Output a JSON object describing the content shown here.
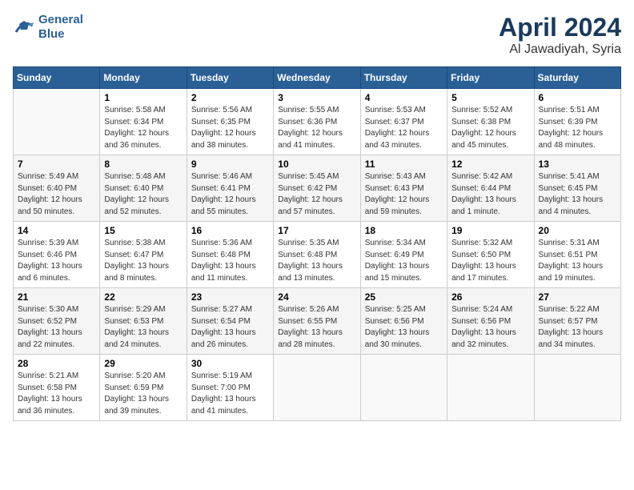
{
  "header": {
    "logo_line1": "General",
    "logo_line2": "Blue",
    "month": "April 2024",
    "location": "Al Jawadiyah, Syria"
  },
  "weekdays": [
    "Sunday",
    "Monday",
    "Tuesday",
    "Wednesday",
    "Thursday",
    "Friday",
    "Saturday"
  ],
  "weeks": [
    [
      {
        "day": "",
        "content": ""
      },
      {
        "day": "1",
        "content": "Sunrise: 5:58 AM\nSunset: 6:34 PM\nDaylight: 12 hours\nand 36 minutes."
      },
      {
        "day": "2",
        "content": "Sunrise: 5:56 AM\nSunset: 6:35 PM\nDaylight: 12 hours\nand 38 minutes."
      },
      {
        "day": "3",
        "content": "Sunrise: 5:55 AM\nSunset: 6:36 PM\nDaylight: 12 hours\nand 41 minutes."
      },
      {
        "day": "4",
        "content": "Sunrise: 5:53 AM\nSunset: 6:37 PM\nDaylight: 12 hours\nand 43 minutes."
      },
      {
        "day": "5",
        "content": "Sunrise: 5:52 AM\nSunset: 6:38 PM\nDaylight: 12 hours\nand 45 minutes."
      },
      {
        "day": "6",
        "content": "Sunrise: 5:51 AM\nSunset: 6:39 PM\nDaylight: 12 hours\nand 48 minutes."
      }
    ],
    [
      {
        "day": "7",
        "content": "Sunrise: 5:49 AM\nSunset: 6:40 PM\nDaylight: 12 hours\nand 50 minutes."
      },
      {
        "day": "8",
        "content": "Sunrise: 5:48 AM\nSunset: 6:40 PM\nDaylight: 12 hours\nand 52 minutes."
      },
      {
        "day": "9",
        "content": "Sunrise: 5:46 AM\nSunset: 6:41 PM\nDaylight: 12 hours\nand 55 minutes."
      },
      {
        "day": "10",
        "content": "Sunrise: 5:45 AM\nSunset: 6:42 PM\nDaylight: 12 hours\nand 57 minutes."
      },
      {
        "day": "11",
        "content": "Sunrise: 5:43 AM\nSunset: 6:43 PM\nDaylight: 12 hours\nand 59 minutes."
      },
      {
        "day": "12",
        "content": "Sunrise: 5:42 AM\nSunset: 6:44 PM\nDaylight: 13 hours\nand 1 minute."
      },
      {
        "day": "13",
        "content": "Sunrise: 5:41 AM\nSunset: 6:45 PM\nDaylight: 13 hours\nand 4 minutes."
      }
    ],
    [
      {
        "day": "14",
        "content": "Sunrise: 5:39 AM\nSunset: 6:46 PM\nDaylight: 13 hours\nand 6 minutes."
      },
      {
        "day": "15",
        "content": "Sunrise: 5:38 AM\nSunset: 6:47 PM\nDaylight: 13 hours\nand 8 minutes."
      },
      {
        "day": "16",
        "content": "Sunrise: 5:36 AM\nSunset: 6:48 PM\nDaylight: 13 hours\nand 11 minutes."
      },
      {
        "day": "17",
        "content": "Sunrise: 5:35 AM\nSunset: 6:48 PM\nDaylight: 13 hours\nand 13 minutes."
      },
      {
        "day": "18",
        "content": "Sunrise: 5:34 AM\nSunset: 6:49 PM\nDaylight: 13 hours\nand 15 minutes."
      },
      {
        "day": "19",
        "content": "Sunrise: 5:32 AM\nSunset: 6:50 PM\nDaylight: 13 hours\nand 17 minutes."
      },
      {
        "day": "20",
        "content": "Sunrise: 5:31 AM\nSunset: 6:51 PM\nDaylight: 13 hours\nand 19 minutes."
      }
    ],
    [
      {
        "day": "21",
        "content": "Sunrise: 5:30 AM\nSunset: 6:52 PM\nDaylight: 13 hours\nand 22 minutes."
      },
      {
        "day": "22",
        "content": "Sunrise: 5:29 AM\nSunset: 6:53 PM\nDaylight: 13 hours\nand 24 minutes."
      },
      {
        "day": "23",
        "content": "Sunrise: 5:27 AM\nSunset: 6:54 PM\nDaylight: 13 hours\nand 26 minutes."
      },
      {
        "day": "24",
        "content": "Sunrise: 5:26 AM\nSunset: 6:55 PM\nDaylight: 13 hours\nand 28 minutes."
      },
      {
        "day": "25",
        "content": "Sunrise: 5:25 AM\nSunset: 6:56 PM\nDaylight: 13 hours\nand 30 minutes."
      },
      {
        "day": "26",
        "content": "Sunrise: 5:24 AM\nSunset: 6:56 PM\nDaylight: 13 hours\nand 32 minutes."
      },
      {
        "day": "27",
        "content": "Sunrise: 5:22 AM\nSunset: 6:57 PM\nDaylight: 13 hours\nand 34 minutes."
      }
    ],
    [
      {
        "day": "28",
        "content": "Sunrise: 5:21 AM\nSunset: 6:58 PM\nDaylight: 13 hours\nand 36 minutes."
      },
      {
        "day": "29",
        "content": "Sunrise: 5:20 AM\nSunset: 6:59 PM\nDaylight: 13 hours\nand 39 minutes."
      },
      {
        "day": "30",
        "content": "Sunrise: 5:19 AM\nSunset: 7:00 PM\nDaylight: 13 hours\nand 41 minutes."
      },
      {
        "day": "",
        "content": ""
      },
      {
        "day": "",
        "content": ""
      },
      {
        "day": "",
        "content": ""
      },
      {
        "day": "",
        "content": ""
      }
    ]
  ]
}
